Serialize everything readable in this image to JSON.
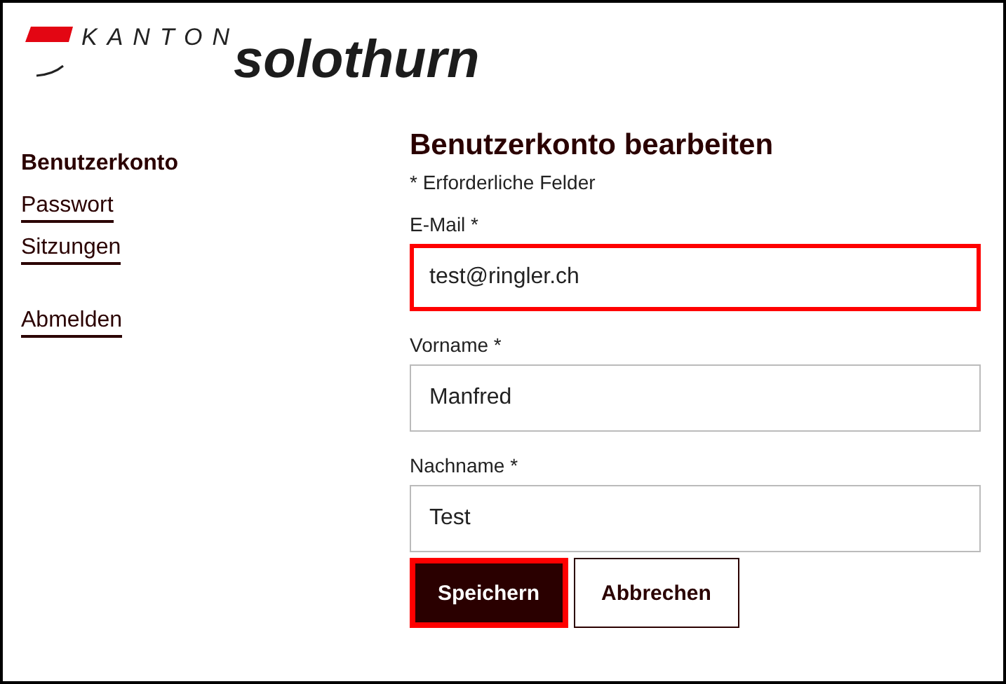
{
  "logo": {
    "kanton": "KANTON",
    "name": "solothurn"
  },
  "sidebar": {
    "items": [
      {
        "label": "Benutzerkonto",
        "selected": true
      },
      {
        "label": "Passwort",
        "selected": false
      },
      {
        "label": "Sitzungen",
        "selected": false
      }
    ],
    "logout": "Abmelden"
  },
  "form": {
    "title": "Benutzerkonto bearbeiten",
    "required_note": "* Erforderliche Felder",
    "fields": [
      {
        "label": "E-Mail",
        "required": "*",
        "value": "test@ringler.ch",
        "focused": true
      },
      {
        "label": "Vorname",
        "required": "*",
        "value": "Manfred",
        "focused": false
      },
      {
        "label": "Nachname",
        "required": "*",
        "value": "Test",
        "focused": false
      }
    ],
    "buttons": [
      {
        "label": "Speichern",
        "kind": "primary",
        "focused": true
      },
      {
        "label": "Abbrechen",
        "kind": "secondary",
        "focused": false
      }
    ]
  }
}
